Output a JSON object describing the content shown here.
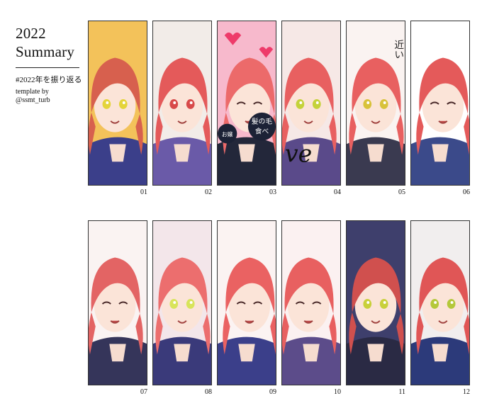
{
  "header": {
    "year": "2022",
    "word": "Summary",
    "hashtag": "#2022年を振り返る",
    "template_by": "template by",
    "author": "@ssmt_turb"
  },
  "panels": [
    {
      "number": "01",
      "bg": "#f3c25a",
      "hair": "#d7604e",
      "eye": "#e4d43a",
      "accent": "#3b3f8a"
    },
    {
      "number": "02",
      "bg": "#f2ece8",
      "hair": "#e45a5a",
      "eye": "#d84a4a",
      "accent": "#6a5aa8"
    },
    {
      "number": "03",
      "bg": "#f7b9cc",
      "hair": "#ec6a6a",
      "eye": "#ec6a6a",
      "accent": "#23273a",
      "fan_text": "髪の毛",
      "fan_text2": "食べ",
      "fan_text3": "お嬢"
    },
    {
      "number": "04",
      "bg": "#f6e8e6",
      "hair": "#e86060",
      "eye": "#c4d23a",
      "accent": "#5a4a8a",
      "script": "ve"
    },
    {
      "number": "05",
      "bg": "#faf3f1",
      "hair": "#e86060",
      "eye": "#d8c23a",
      "accent": "#3a3a50",
      "text": "近い"
    },
    {
      "number": "06",
      "bg": "#ffffff",
      "hair": "#e45a5a",
      "eye": "#e45a5a",
      "accent": "#3b4a8a"
    },
    {
      "number": "07",
      "bg": "#faf3f2",
      "hair": "#e36464",
      "eye": "#c8d63a",
      "accent": "#35355a"
    },
    {
      "number": "08",
      "bg": "#f3e6ea",
      "hair": "#ec6e6e",
      "eye": "#d8e45a",
      "accent": "#3a3a7a"
    },
    {
      "number": "09",
      "bg": "#fbf3f2",
      "hair": "#ea6262",
      "eye": "#ea6262",
      "accent": "#3b3f8a"
    },
    {
      "number": "10",
      "bg": "#fbf1f1",
      "hair": "#e86060",
      "eye": "#e86060",
      "accent": "#5c4c8a"
    },
    {
      "number": "11",
      "bg": "#3e3f6c",
      "hair": "#d0504e",
      "eye": "#c8d03a",
      "accent": "#2a2a44"
    },
    {
      "number": "12",
      "bg": "#f1eeee",
      "hair": "#e05656",
      "eye": "#b4c83a",
      "accent": "#2c3a7a"
    }
  ]
}
